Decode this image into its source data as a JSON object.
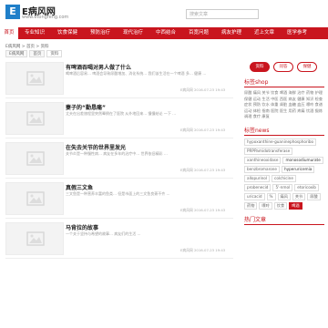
{
  "header": {
    "logo_letter": "E",
    "logo_name": "E病风网",
    "logo_url": "www.etongfeng.com",
    "search_placeholder": "搜索文章"
  },
  "nav": [
    {
      "label": "首页"
    },
    {
      "label": "专业知识"
    },
    {
      "label": "饮食保健"
    },
    {
      "label": "预防治疗"
    },
    {
      "label": "现代治疗"
    },
    {
      "label": "中西结合"
    },
    {
      "label": "百宽问题"
    },
    {
      "label": "病友护理"
    },
    {
      "label": "近上文章"
    },
    {
      "label": "医学参考"
    }
  ],
  "breadcrumb": "E病风网 > 首页 > 资料",
  "tabs": [
    {
      "label": "E病风网"
    },
    {
      "label": "首页"
    },
    {
      "label": "资料"
    }
  ],
  "articles": [
    {
      "title": "有啤酒吞喝对男人做了什么",
      "summary": "喝啤酒后容易… 啤酒会导致尿酸增加、消化系统… 我们该生活在一个啤酒 多… 健康 …",
      "meta": "E病风网  2016-07-23 19:43"
    },
    {
      "title": "妻子的“勤恳痛”",
      "summary": "丈夫在出差旅程里突然晕倒在了医院 从外地回来… 慢慢结论 一下 …",
      "meta": "E病风网  2016-07-23 19:43"
    },
    {
      "title": "在失去关节的世界里发光",
      "summary": "关节炎是一种慢性病… 病友在多年的治疗中… 世界依旧精彩 …",
      "meta": "E病风网  2016-07-23 19:43"
    },
    {
      "title": "真假三文鱼",
      "summary": "三文鱼是一种营养丰富的鱼类… 但是市面上的三文鱼良莠不齐 …",
      "meta": "E病风网  2016-07-23 19:43"
    },
    {
      "title": "马背拉的故事",
      "summary": "一个关于坚持与希望的故事… 病友们的生活 …",
      "meta": "E病风网  2016-07-23 19:43"
    }
  ],
  "sidebar": {
    "pills": [
      {
        "label": "资料"
      },
      {
        "label": "问答"
      },
      {
        "label": "保健"
      }
    ],
    "sections": [
      {
        "title": "标签shop",
        "keywords": "尿酸 痛风 关节 饮食 啤酒 海鲜 治疗 药物 护理 保健 运动 生活 中医 西医 病友 健康 知识 检查 症状 预防 饮水 体重 肾脏 血糖 血压 嘌呤 食谱 运动 体检 指南 医院 医生 用药 疼痛 饮酒 锻炼 调理 食疗 康复"
      },
      {
        "title": "标签news",
        "tags": [
          {
            "label": "hypoxanthine-guaninephosphoribo"
          },
          {
            "label": "PRPPamidotransferase"
          },
          {
            "label": "xanthineoxidase"
          },
          {
            "label": "monosodiumurate",
            "dark": true
          },
          {
            "label": "benzbromarone"
          },
          {
            "label": "hyperuricemia",
            "dark": true
          },
          {
            "label": "allopurinol"
          },
          {
            "label": "colchicine"
          },
          {
            "label": "probenecid"
          },
          {
            "label": "5'-nmol"
          },
          {
            "label": "etoricoxib"
          },
          {
            "label": "uricacid"
          },
          {
            "label": "%"
          },
          {
            "label": "痛风"
          },
          {
            "label": "关节"
          },
          {
            "label": "尿酸"
          },
          {
            "label": "药物"
          },
          {
            "label": "嘌呤"
          },
          {
            "label": "饮食"
          },
          {
            "label": "啤酒",
            "red": true
          }
        ]
      },
      {
        "title": "热门文章"
      }
    ]
  }
}
